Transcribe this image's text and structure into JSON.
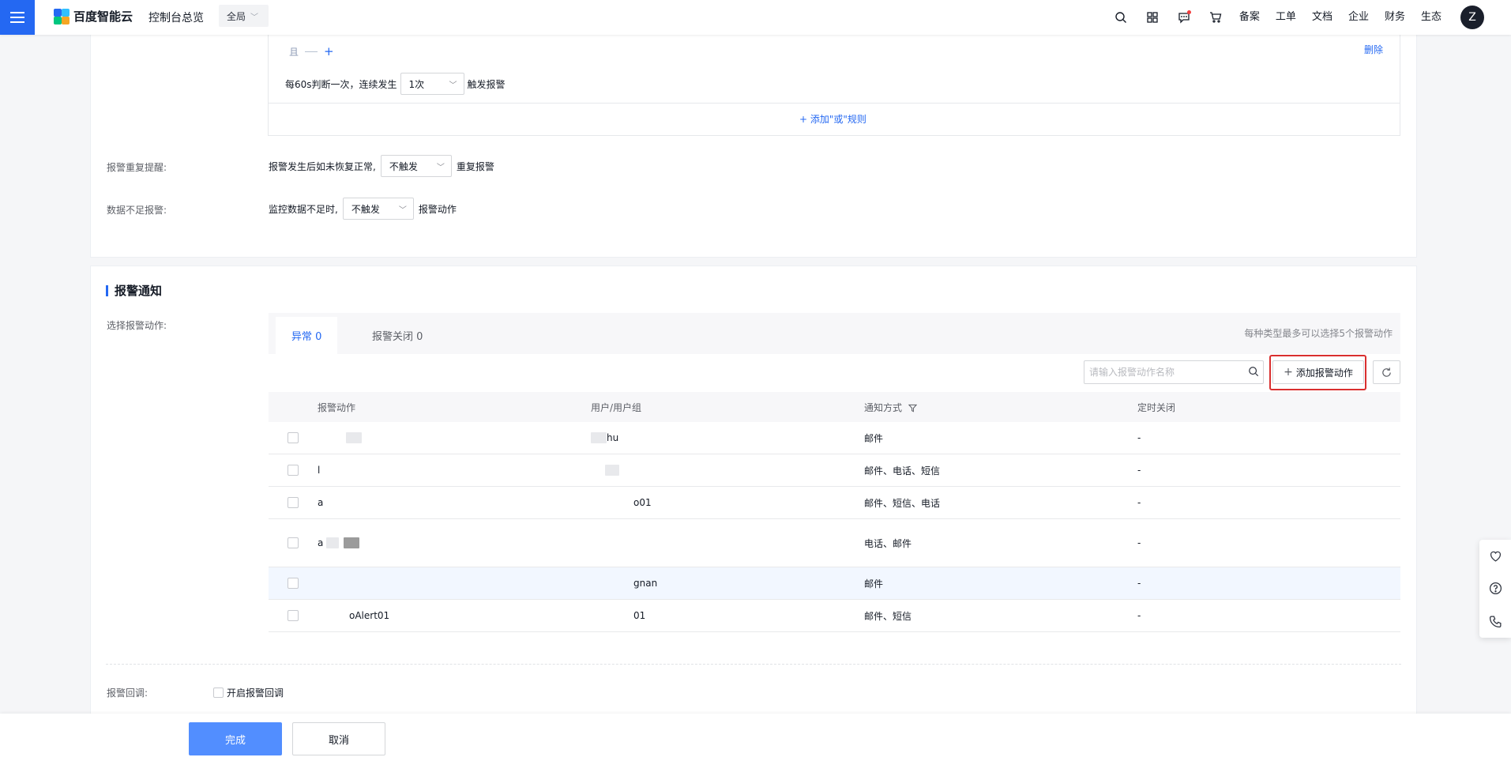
{
  "topbar": {
    "brand": "百度智能云",
    "console": "控制台总览",
    "scope": "全局",
    "links": [
      "备案",
      "工单",
      "文档",
      "企业",
      "财务",
      "生态"
    ],
    "avatar_letter": "Z",
    "icons": [
      "search-icon",
      "apps-icon",
      "message-icon",
      "cart-icon"
    ]
  },
  "rule": {
    "and_label": "且",
    "delete_label": "删除",
    "freq_prefix": "每60s判断一次，连续发生",
    "freq_value": "1次",
    "freq_suffix": "触发报警",
    "add_or": "添加\"或\"规则"
  },
  "repeat": {
    "label": "报警重复提醒:",
    "prefix": "报警发生后如未恢复正常,",
    "value": "不触发",
    "suffix": "重复报警"
  },
  "insufficient": {
    "label": "数据不足报警:",
    "prefix": "监控数据不足时,",
    "value": "不触发",
    "suffix": "报警动作"
  },
  "notify": {
    "title": "报警通知",
    "select_label": "选择报警动作:",
    "tabs": [
      {
        "label": "异常 0"
      },
      {
        "label": "报警关闭 0"
      }
    ],
    "tab_note": "每种类型最多可以选择5个报警动作",
    "search_placeholder": "请输入报警动作名称",
    "add_button": "添加报警动作",
    "columns": [
      "报警动作",
      "用户/用户组",
      "通知方式",
      "定时关闭"
    ],
    "rows": [
      {
        "action": "",
        "user": "hu",
        "method": "邮件",
        "close": "-"
      },
      {
        "action": "l",
        "user": "",
        "method": "邮件、电话、短信",
        "close": "-"
      },
      {
        "action": "a",
        "user": "o01",
        "method": "邮件、短信、电话",
        "close": "-"
      },
      {
        "action": "a",
        "user": "",
        "method": "电话、邮件",
        "close": "-"
      },
      {
        "action": "",
        "user": "gnan",
        "method": "邮件",
        "close": "-"
      },
      {
        "action": "oAlert01",
        "user": "01",
        "method": "邮件、短信",
        "close": "-"
      }
    ]
  },
  "callback": {
    "label": "报警回调:",
    "checkbox_label": "开启报警回调"
  },
  "footer": {
    "done": "完成",
    "cancel": "取消"
  }
}
